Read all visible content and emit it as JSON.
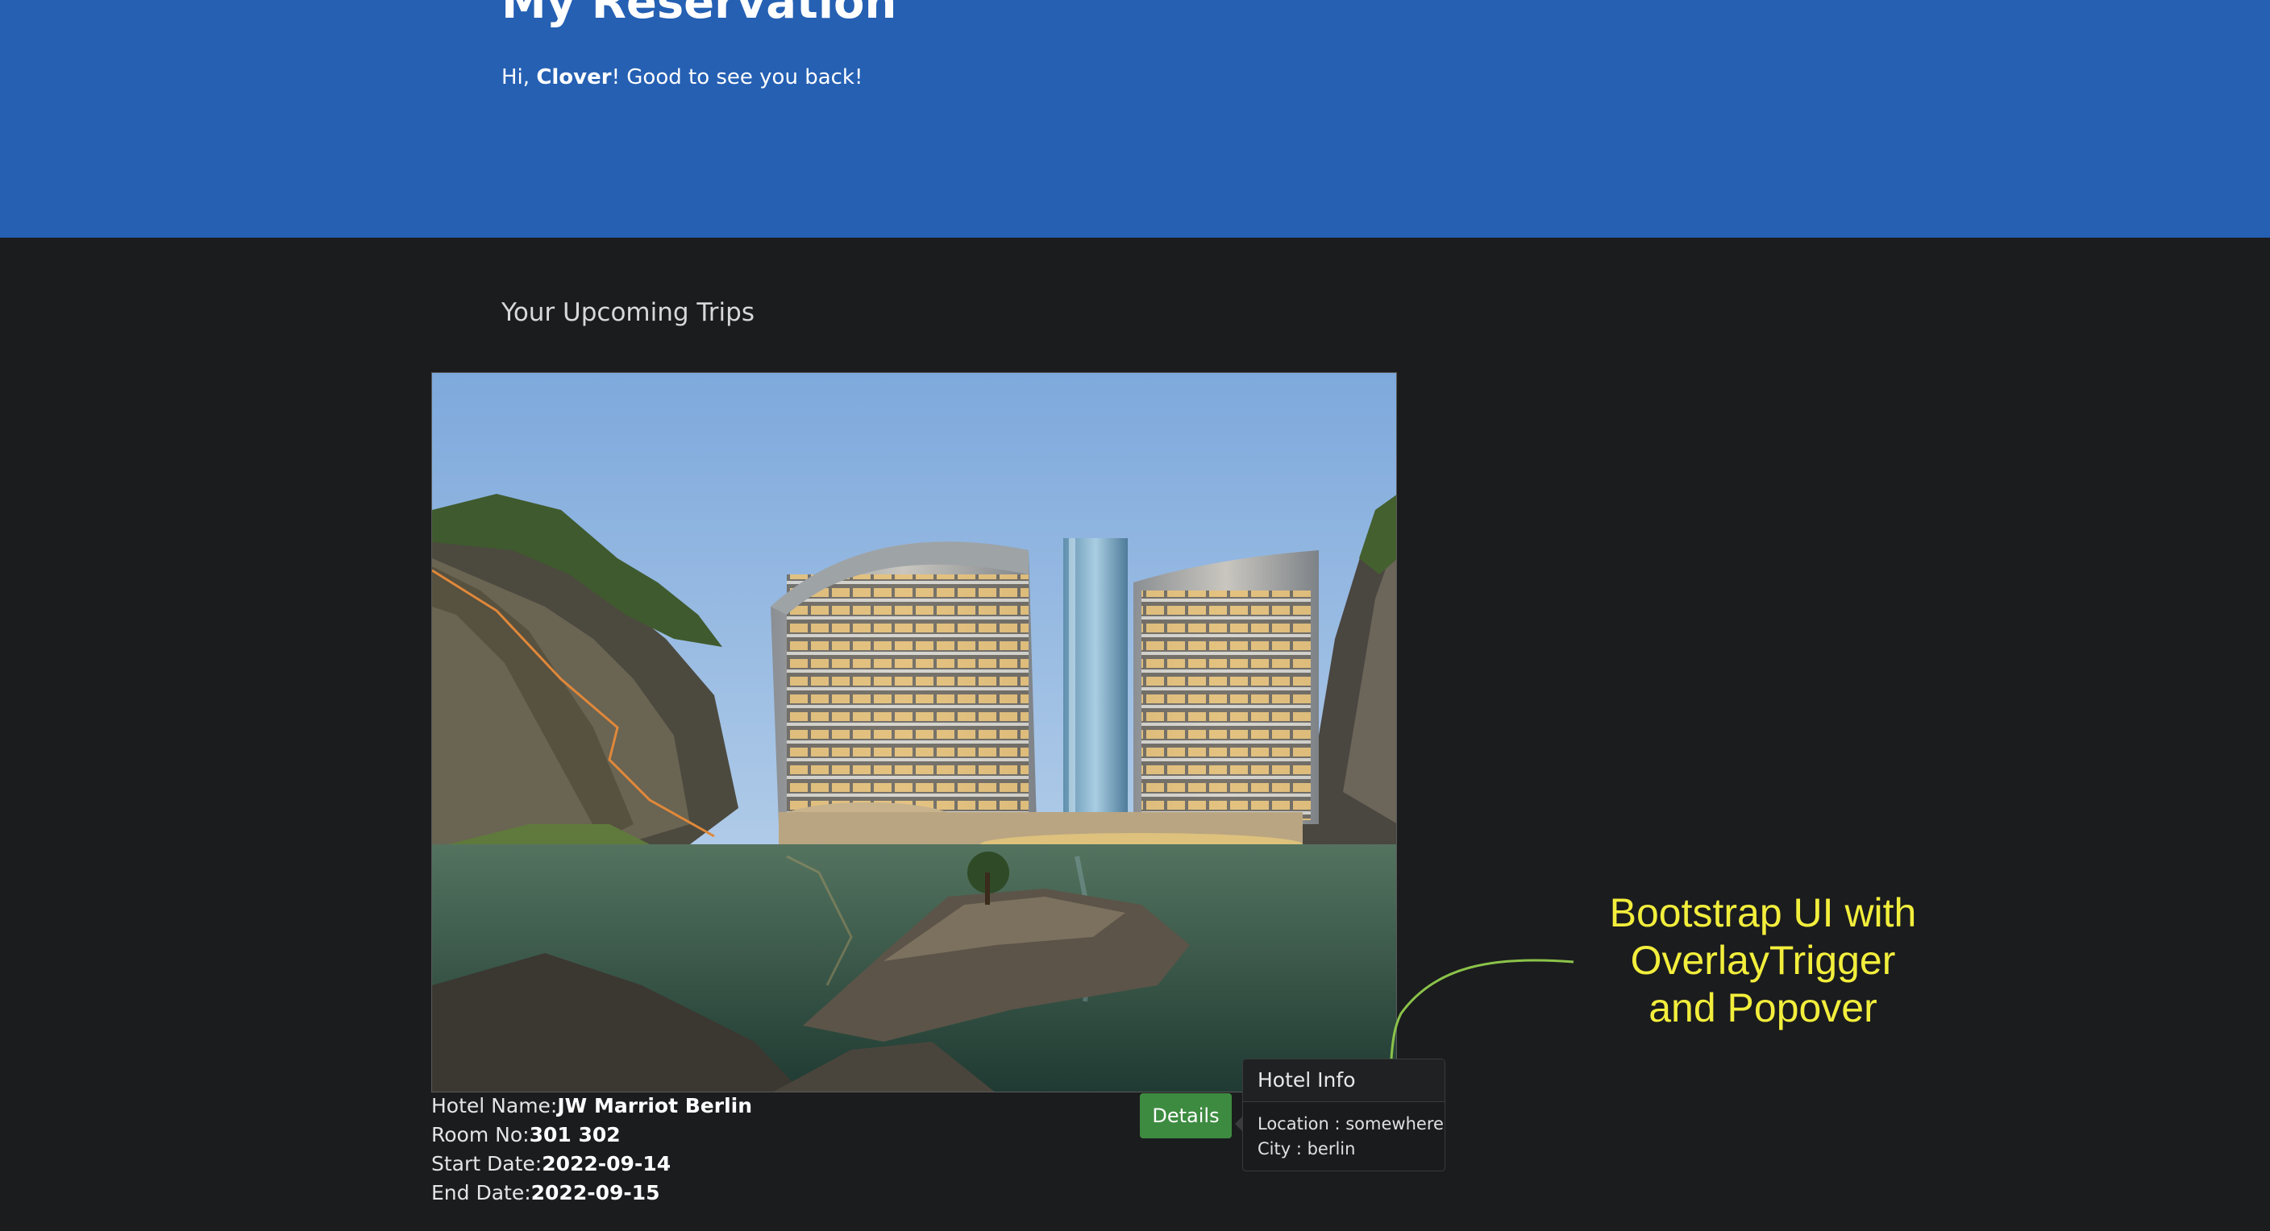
{
  "hero": {
    "title": "My Reservation",
    "greeting_prefix": "Hi, ",
    "user_name": "Clover",
    "greeting_suffix": "! Good to see you back!"
  },
  "section": {
    "heading": "Your Upcoming Trips"
  },
  "trip": {
    "hotel_name_label": "Hotel Name:",
    "hotel_name": "JW Marriot Berlin",
    "room_label": "Room No:",
    "room": "301 302",
    "start_label": "Start Date:",
    "start_date": "2022-09-14",
    "end_label": "End Date:",
    "end_date": "2022-09-15",
    "details_button": "Details"
  },
  "popover": {
    "title": "Hotel Info",
    "location": "Location : somewhere",
    "city": "City : berlin"
  },
  "annotation": {
    "line1": "Bootstrap UI with",
    "line2": "OverlayTrigger",
    "line3": "and Popover"
  },
  "colors": {
    "hero_bg": "#2560b3",
    "page_bg": "#1b1c1e",
    "button_green": "#3d8b40",
    "annotation_yellow": "#f2ee3c",
    "annotation_curve_green": "#8bc34a"
  }
}
